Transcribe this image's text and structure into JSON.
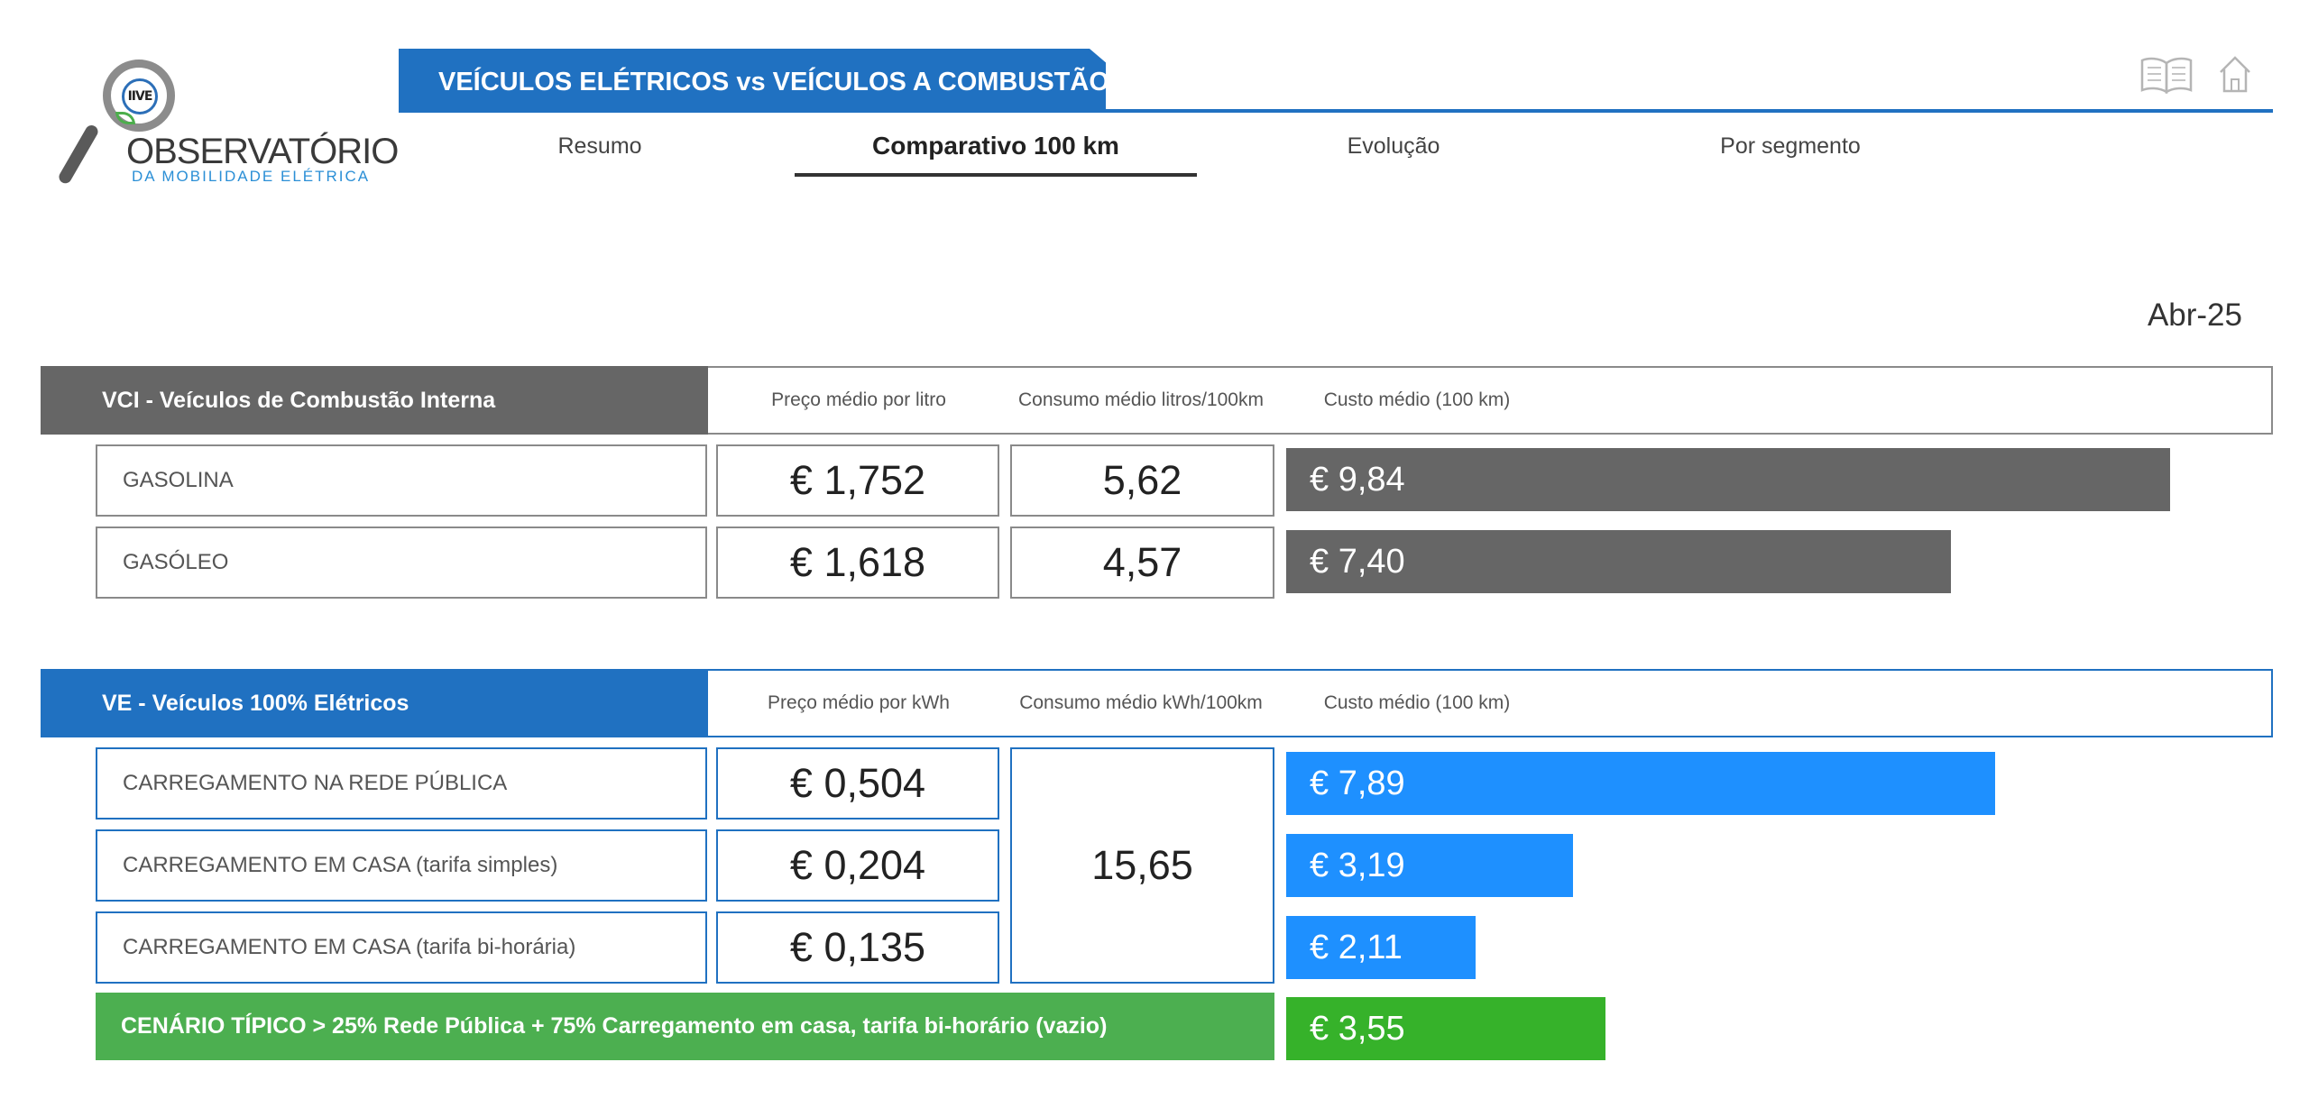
{
  "logo": {
    "badge": "IIVE",
    "title": "OBSERVATÓRIO",
    "subtitle": "DA MOBILIDADE ELÉTRICA"
  },
  "header": {
    "title": "VEÍCULOS ELÉTRICOS vs VEÍCULOS A COMBUSTÃO",
    "icons": [
      "book-icon",
      "home-icon"
    ]
  },
  "tabs": [
    {
      "label": "Resumo",
      "active": false
    },
    {
      "label": "Comparativo 100 km",
      "active": true
    },
    {
      "label": "Evolução",
      "active": false
    },
    {
      "label": "Por segmento",
      "active": false
    }
  ],
  "period": "Abr-25",
  "vci": {
    "title": "VCI - Veículos de Combustão Interna",
    "col_price": "Preço médio por litro",
    "col_consumption": "Consumo médio litros/100km",
    "col_cost": "Custo médio (100 km)",
    "rows": [
      {
        "label": "GASOLINA",
        "price": "€ 1,752",
        "consumption": "5,62",
        "cost_label": "€ 9,84",
        "cost_value": 9.84
      },
      {
        "label": "GASÓLEO",
        "price": "€ 1,618",
        "consumption": "4,57",
        "cost_label": "€ 7,40",
        "cost_value": 7.4
      }
    ]
  },
  "ve": {
    "title": "VE - Veículos 100% Elétricos",
    "col_price": "Preço médio por kWh",
    "col_consumption": "Consumo médio kWh/100km",
    "col_cost": "Custo médio (100 km)",
    "consumption": "15,65",
    "rows": [
      {
        "label": "CARREGAMENTO NA REDE PÚBLICA",
        "price": "€ 0,504",
        "cost_label": "€ 7,89",
        "cost_value": 7.89
      },
      {
        "label": "CARREGAMENTO EM CASA (tarifa simples)",
        "price": "€ 0,204",
        "cost_label": "€ 3,19",
        "cost_value": 3.19
      },
      {
        "label": "CARREGAMENTO EM CASA (tarifa bi-horária)",
        "price": "€ 0,135",
        "cost_label": "€ 2,11",
        "cost_value": 2.11
      }
    ]
  },
  "scenario": {
    "label": "CENÁRIO TÍPICO > 25% Rede Pública + 75% Carregamento em casa, tarifa bi-horário (vazio)",
    "cost_label": "€ 3,55",
    "cost_value": 3.55
  },
  "colors": {
    "primary_blue": "#2071c1",
    "ve_bar": "#1e90ff",
    "vci_bar": "#666666",
    "scenario_green": "#4caf50",
    "scenario_bar": "#36b22a"
  }
}
